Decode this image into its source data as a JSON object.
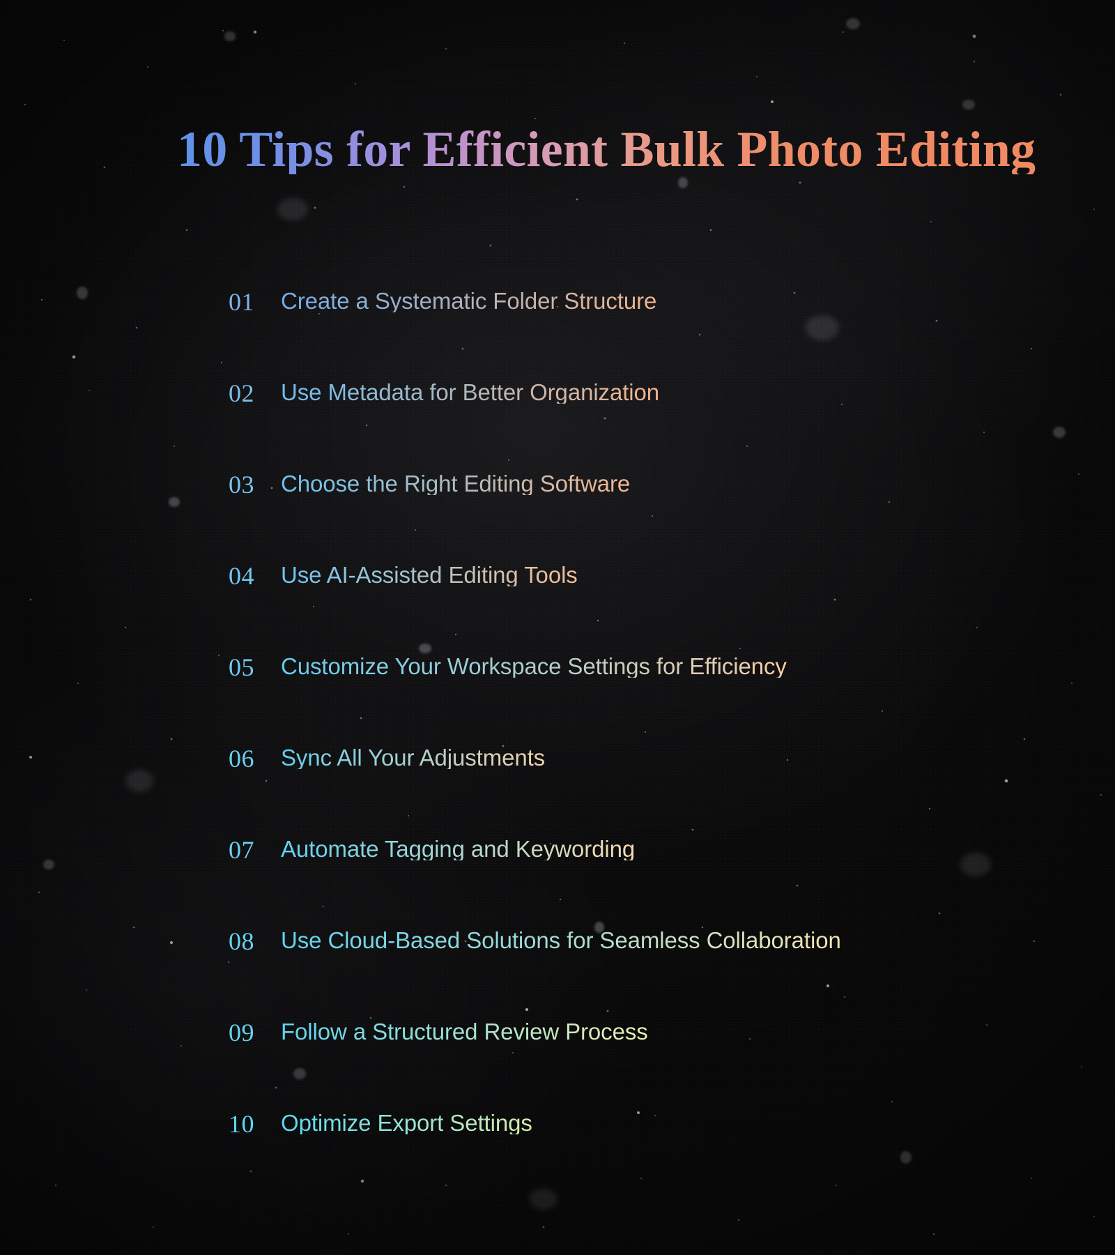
{
  "page": {
    "background_color": "#0a0a0b",
    "texture": "starfield-halftone"
  },
  "header": {
    "title": "10 Tips for Efficient Bulk Photo Editing",
    "title_gradient_start": "#5f93ea",
    "title_gradient_mid": "#c293c8",
    "title_gradient_end": "#f08a63"
  },
  "list": {
    "items": [
      {
        "number": "01",
        "label": "Create a Systematic Folder Structure",
        "number_color": "#7fb4ea",
        "gradient_from": "#72aee8",
        "gradient_to": "#f2b390"
      },
      {
        "number": "02",
        "label": "Use Metadata for Better Organization",
        "number_color": "#79bfee",
        "gradient_from": "#6fbcee",
        "gradient_to": "#f4b48c"
      },
      {
        "number": "03",
        "label": "Choose the Right Editing Software",
        "number_color": "#76c4ef",
        "gradient_from": "#6cc2f0",
        "gradient_to": "#f5b78e"
      },
      {
        "number": "04",
        "label": "Use AI-Assisted Editing Tools",
        "number_color": "#73c8f0",
        "gradient_from": "#6ac7f1",
        "gradient_to": "#f6be97"
      },
      {
        "number": "05",
        "label": "Customize Your Workspace Settings for Efficiency",
        "number_color": "#6fcbf1",
        "gradient_from": "#67cbf2",
        "gradient_to": "#f8cfa5"
      },
      {
        "number": "06",
        "label": "Sync All Your Adjustments",
        "number_color": "#6ccef1",
        "gradient_from": "#64cef2",
        "gradient_to": "#f5d3a9"
      },
      {
        "number": "07",
        "label": "Automate Tagging and Keywording",
        "number_color": "#69d0f1",
        "gradient_from": "#61d1f2",
        "gradient_to": "#f6dcae"
      },
      {
        "number": "08",
        "label": "Use Cloud-Based Solutions for Seamless Collaboration",
        "number_color": "#66d2f1",
        "gradient_from": "#5ed4f2",
        "gradient_to": "#f4e4b2"
      },
      {
        "number": "09",
        "label": "Follow a Structured Review Process",
        "number_color": "#62d4f1",
        "gradient_from": "#5bd6f2",
        "gradient_to": "#eeeeae"
      },
      {
        "number": "10",
        "label": "Optimize Export Settings",
        "number_color": "#5fd6f1",
        "gradient_from": "#58d9f2",
        "gradient_to": "#d9f0ae"
      }
    ]
  }
}
